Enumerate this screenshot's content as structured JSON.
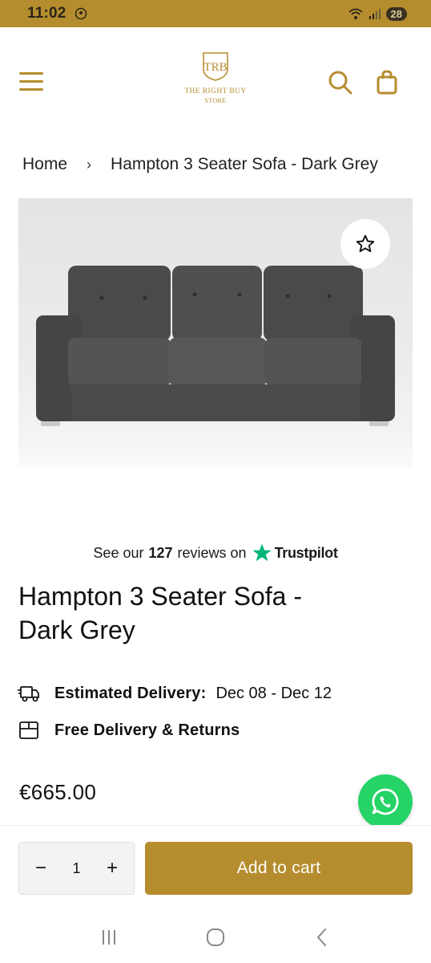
{
  "status_bar": {
    "time": "11:02",
    "battery": "28"
  },
  "header": {
    "logo_monogram": "TRB",
    "logo_line1": "THE RIGHT BUY",
    "logo_line2": "STORE"
  },
  "breadcrumb": {
    "home": "Home",
    "separator": "›",
    "current": "Hampton 3 Seater Sofa - Dark Grey"
  },
  "trustpilot": {
    "prefix": "See our",
    "count": "127",
    "suffix": "reviews on",
    "brand": "Trustpilot"
  },
  "product": {
    "title": "Hampton 3 Seater Sofa - Dark Grey",
    "price": "€665.00"
  },
  "delivery": {
    "estimated_label": "Estimated Delivery:",
    "estimated_value": "Dec 08 - Dec 12",
    "free_label": "Free Delivery & Returns"
  },
  "cart": {
    "minus": "−",
    "quantity": "1",
    "plus": "+",
    "add_to_cart": "Add to cart"
  },
  "colors": {
    "brand_gold": "#b58d2e",
    "whatsapp_green": "#25d366",
    "trustpilot_green": "#00b67a"
  },
  "icons": [
    "menu-icon",
    "search-icon",
    "bag-icon",
    "star-outline-icon",
    "trustpilot-star-icon",
    "delivery-truck-icon",
    "box-icon",
    "whatsapp-icon",
    "recents-icon",
    "home-icon",
    "back-icon"
  ]
}
